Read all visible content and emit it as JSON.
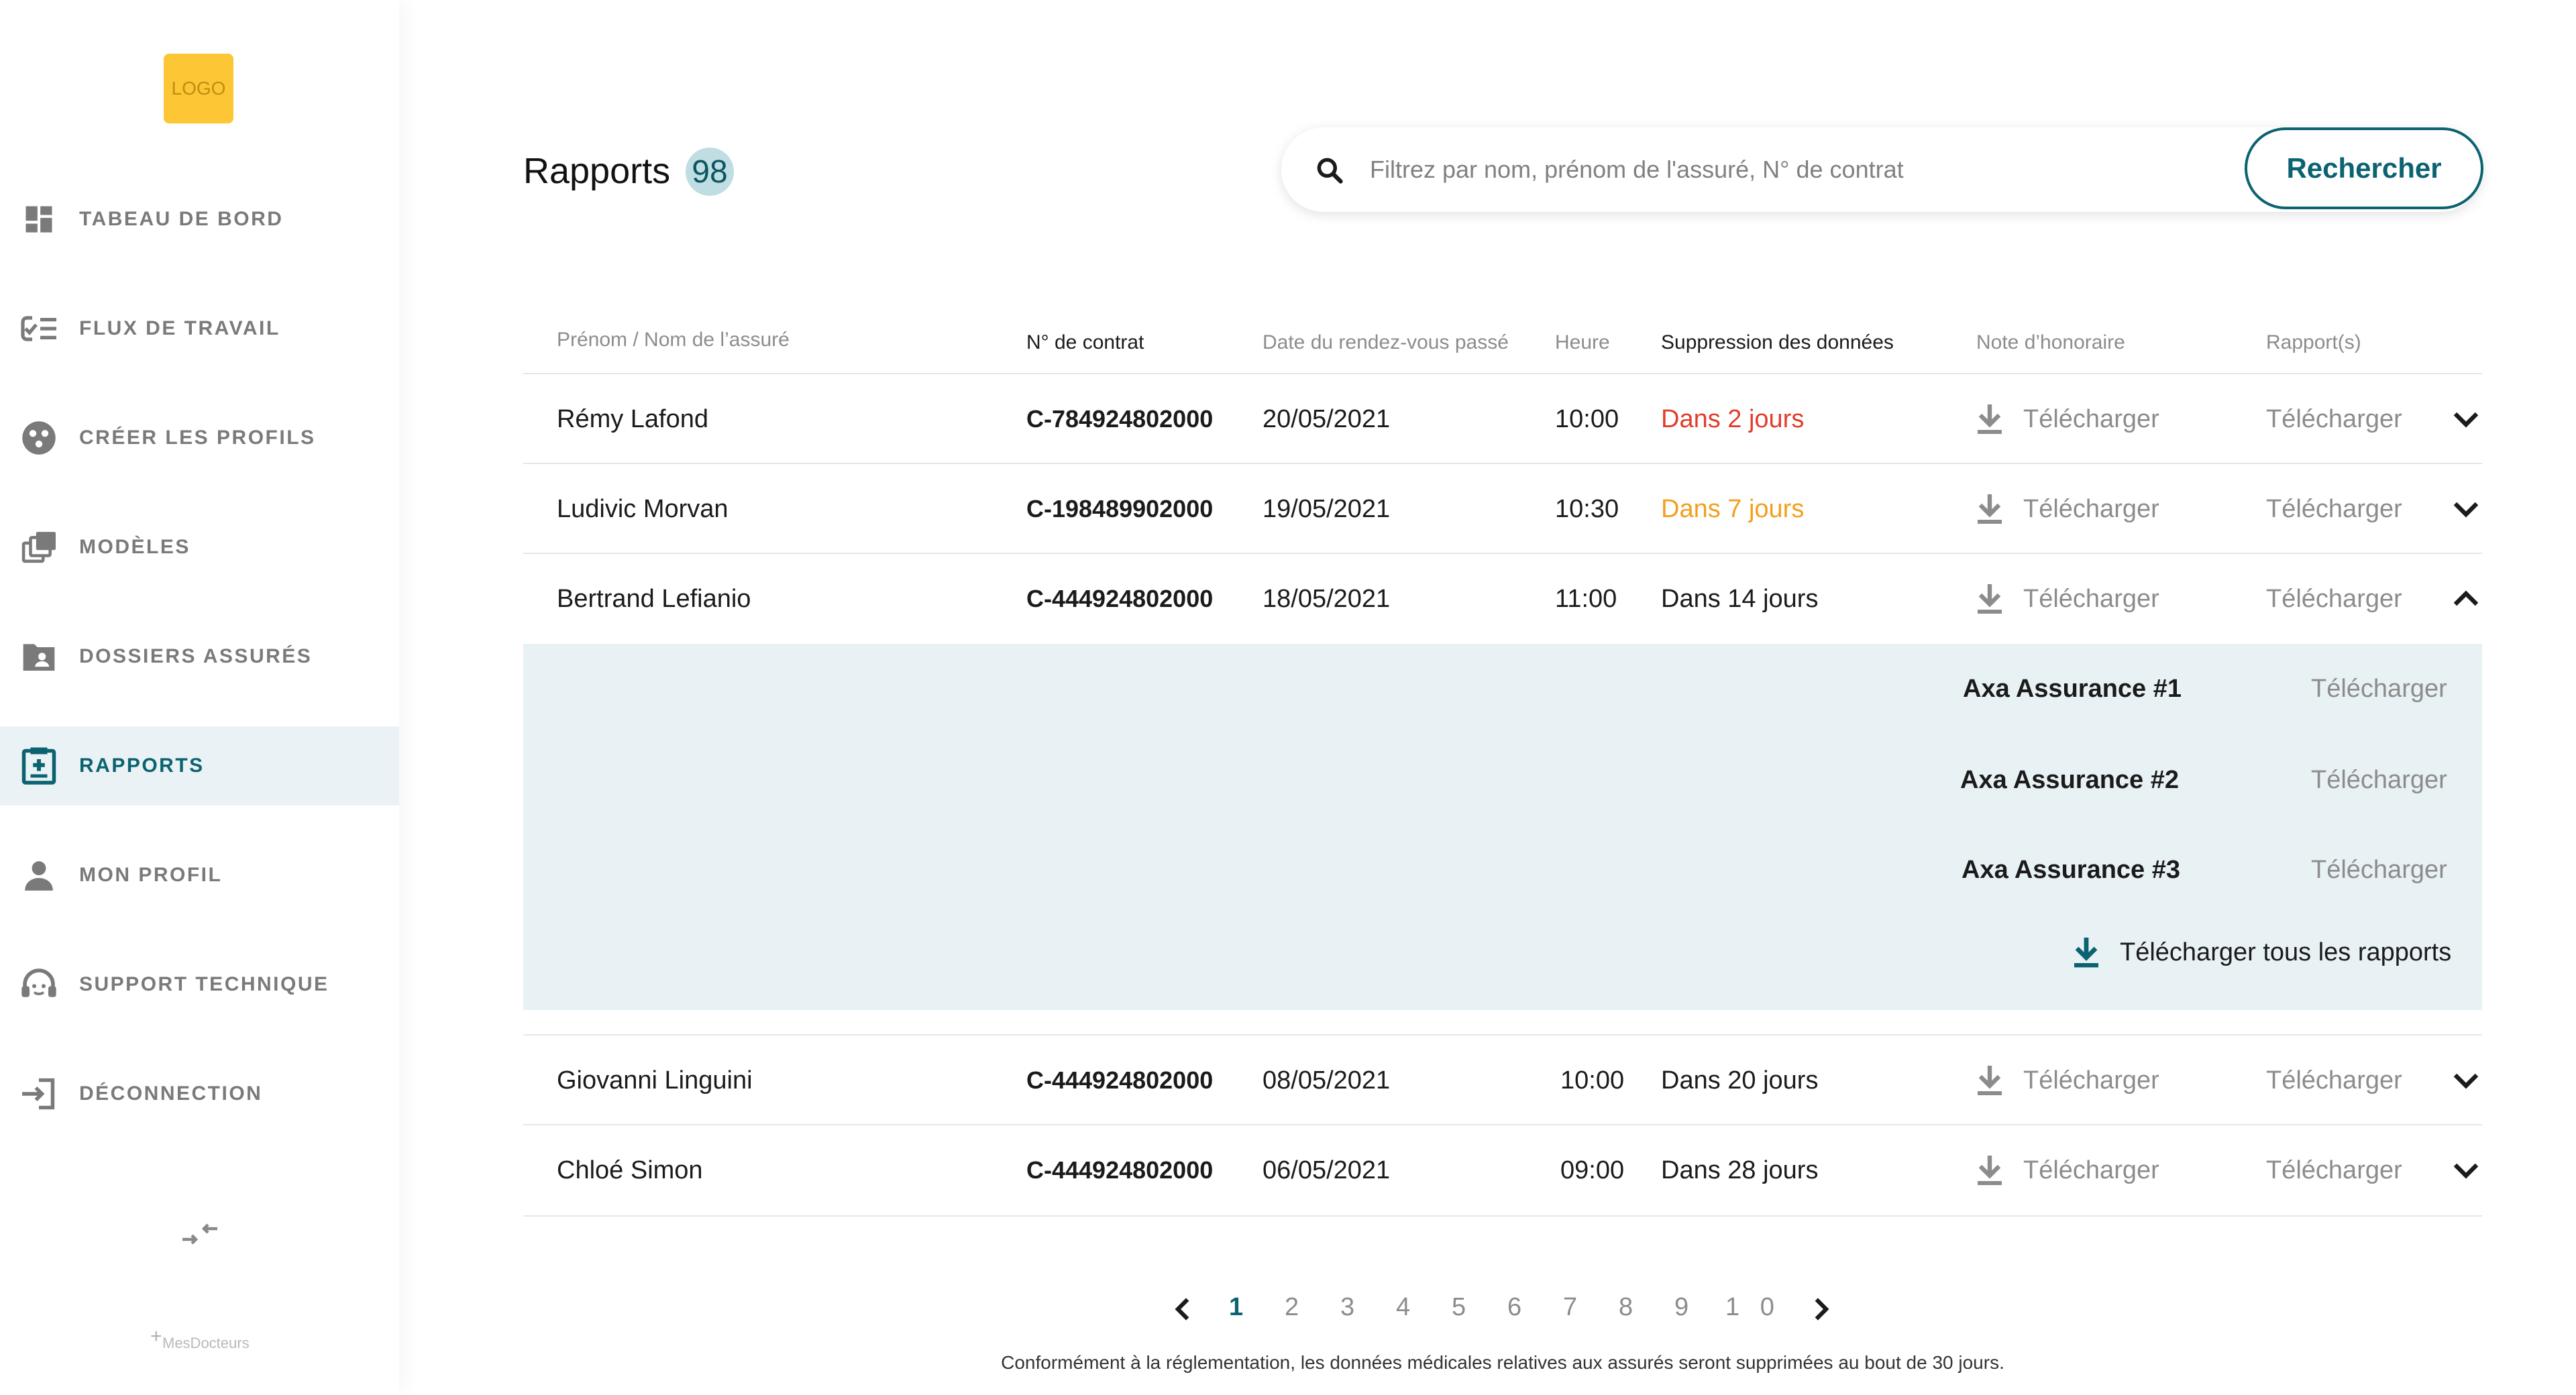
{
  "sidebar": {
    "logo": "LOGO",
    "items": [
      {
        "label": "TABEAU DE BORD",
        "icon": "dashboard-icon"
      },
      {
        "label": "FLUX DE TRAVAIL",
        "icon": "workflow-icon"
      },
      {
        "label": "CRÉER LES PROFILS",
        "icon": "create-profiles-icon"
      },
      {
        "label": "MODÈLES",
        "icon": "templates-icon"
      },
      {
        "label": "DOSSIERS ASSURÉS",
        "icon": "insured-folders-icon"
      },
      {
        "label": "RAPPORTS",
        "icon": "reports-icon",
        "active": true
      },
      {
        "label": "MON PROFIL",
        "icon": "profile-icon"
      },
      {
        "label": "SUPPORT TECHNIQUE",
        "icon": "support-icon"
      },
      {
        "label": "DÉCONNECTION",
        "icon": "logout-icon"
      }
    ],
    "brand": "MesDocteurs"
  },
  "header": {
    "title": "Rapports",
    "count": "98"
  },
  "search": {
    "placeholder": "Filtrez par nom, prénom de l'assuré, N° de contrat",
    "button": "Rechercher"
  },
  "table": {
    "headers": {
      "name": "Prénom / Nom de l’assuré",
      "contract": "N° de contrat",
      "date": "Date du rendez-vous passé",
      "time": "Heure",
      "deletion": "Suppression des données",
      "fee": "Note d’honoraire",
      "reports": "Rapport(s)"
    },
    "rows": [
      {
        "name": "Rémy Lafond",
        "contract": "C-784924802000",
        "date": "20/05/2021",
        "time": "10:00",
        "deletion": "Dans 2 jours",
        "fee": "Télécharger",
        "reports": "Télécharger"
      },
      {
        "name": "Ludivic Morvan",
        "contract": "C-198489902000",
        "date": "19/05/2021",
        "time": "10:30",
        "deletion": "Dans 7 jours",
        "fee": "Télécharger",
        "reports": "Télécharger"
      },
      {
        "name": "Bertrand Lefianio",
        "contract": "C-444924802000",
        "date": "18/05/2021",
        "time": "11:00",
        "deletion": "Dans 14 jours",
        "fee": "Télécharger",
        "reports": "Télécharger"
      },
      {
        "name": "Giovanni Linguini",
        "contract": "C-444924802000",
        "date": "08/05/2021",
        "time": "10:00",
        "deletion": "Dans 20 jours",
        "fee": "Télécharger",
        "reports": "Télécharger"
      },
      {
        "name": "Chloé Simon",
        "contract": "C-444924802000",
        "date": "06/05/2021",
        "time": "09:00",
        "deletion": "Dans 28 jours",
        "fee": "Télécharger",
        "reports": "Télécharger"
      }
    ],
    "expanded": {
      "reports": [
        {
          "name": "Axa Assurance #1",
          "action": "Télécharger"
        },
        {
          "name": "Axa Assurance #2",
          "action": "Télécharger"
        },
        {
          "name": "Axa Assurance #3",
          "action": "Télécharger"
        }
      ],
      "download_all": "Télécharger tous les rapports"
    }
  },
  "pagination": {
    "pages": [
      "1",
      "2",
      "3",
      "4",
      "5",
      "6",
      "7",
      "8",
      "9",
      "1 0"
    ],
    "current": "1"
  },
  "footnote": "Conformément à la réglementation, les données médicales relatives aux assurés seront supprimées au bout de 30 jours.",
  "colors": {
    "accent": "#0b6270",
    "badge": "#bfdde2",
    "logo": "#fcc634",
    "urgent": "#e23d2b",
    "warning": "#f2a01c",
    "expanded_bg": "#e8f1f4"
  }
}
